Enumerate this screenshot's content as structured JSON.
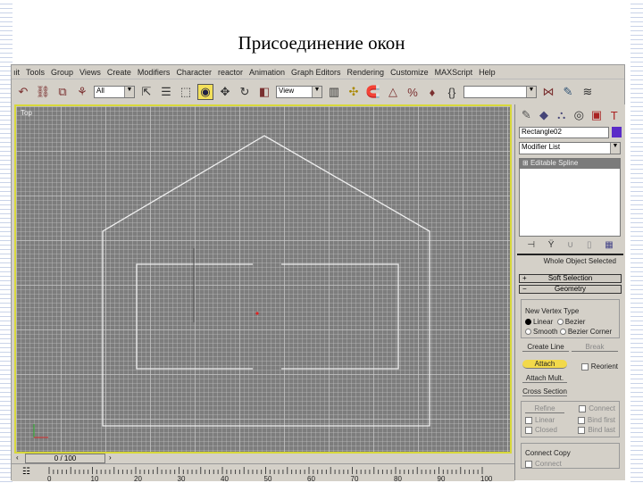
{
  "slide_title": "Присоединение окон",
  "menu": [
    "ıit",
    "Tools",
    "Group",
    "Views",
    "Create",
    "Modifiers",
    "Character",
    "reactor",
    "Animation",
    "Graph Editors",
    "Rendering",
    "Customize",
    "MAXScript",
    "Help"
  ],
  "toolbar": {
    "selection_filter": "All",
    "ref_coord": "View"
  },
  "viewport": {
    "label": "Top"
  },
  "command_panel": {
    "object_name": "Rectangle02",
    "object_color": "#5a2cc8",
    "modifier_list": "Modifier List",
    "stack": [
      "Editable Spline"
    ],
    "whole_object": "Whole Object Selected",
    "rollouts": {
      "soft_selection": "Soft Selection",
      "geometry": "Geometry"
    },
    "new_vertex_type": {
      "label": "New Vertex Type",
      "options": [
        "Linear",
        "Bezier",
        "Smooth",
        "Bezier Corner"
      ],
      "selected": "Linear"
    },
    "buttons": {
      "create_line": "Create Line",
      "break": "Break",
      "attach": "Attach",
      "attach_mult": "Attach Mult.",
      "reorient": "Reorient",
      "cross_section": "Cross Section",
      "refine": "Refine",
      "connect": "Connect",
      "linear": "Linear",
      "bind_first": "Bind first",
      "closed": "Closed",
      "bind_last": "Bind last"
    },
    "connect_copy": {
      "label": "Connect Copy",
      "connect": "Connect"
    }
  },
  "time_slider": {
    "value": "0 / 100"
  },
  "track_ticks": [
    "0",
    "10",
    "20",
    "30",
    "40",
    "50",
    "60",
    "70",
    "80",
    "90",
    "100"
  ]
}
